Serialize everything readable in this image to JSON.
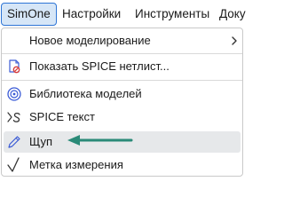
{
  "menubar": {
    "items": [
      {
        "label": "SimOne"
      },
      {
        "label": "Настройки"
      },
      {
        "label": "Инструменты"
      },
      {
        "label": "Доку"
      }
    ]
  },
  "dropdown": {
    "items": [
      {
        "label": "Новое моделирование",
        "icon": "chevron-right-icon",
        "submenu": true
      },
      {
        "label": "Показать SPICE нетлист...",
        "icon": "netlist-document-icon"
      },
      {
        "label": "Библиотека моделей",
        "icon": "model-library-icon"
      },
      {
        "label": "SPICE текст",
        "icon": "spice-text-icon"
      },
      {
        "label": "Щуп",
        "icon": "probe-pen-icon",
        "hovered": true
      },
      {
        "label": "Метка измерения",
        "icon": "checkmark-icon"
      }
    ]
  },
  "colors": {
    "accent": "#2e75d6",
    "active_bg": "#d6e6f7",
    "hover_bg": "#e6e8ea",
    "arrow": "#2a8a78",
    "netlist_icon_red": "#d63b3b"
  }
}
